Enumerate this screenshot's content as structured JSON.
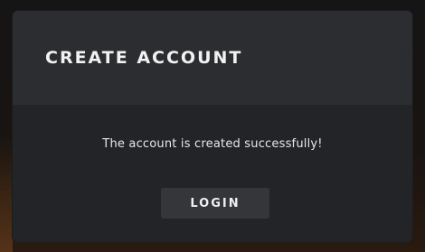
{
  "dialog": {
    "title": "CREATE ACCOUNT",
    "message": "The account is created successfully!",
    "login_label": "LOGIN"
  },
  "colors": {
    "dialog_header": "#2b2d30",
    "dialog_body": "#222427",
    "button_bg": "#34363a",
    "text": "#f2f2f2"
  }
}
